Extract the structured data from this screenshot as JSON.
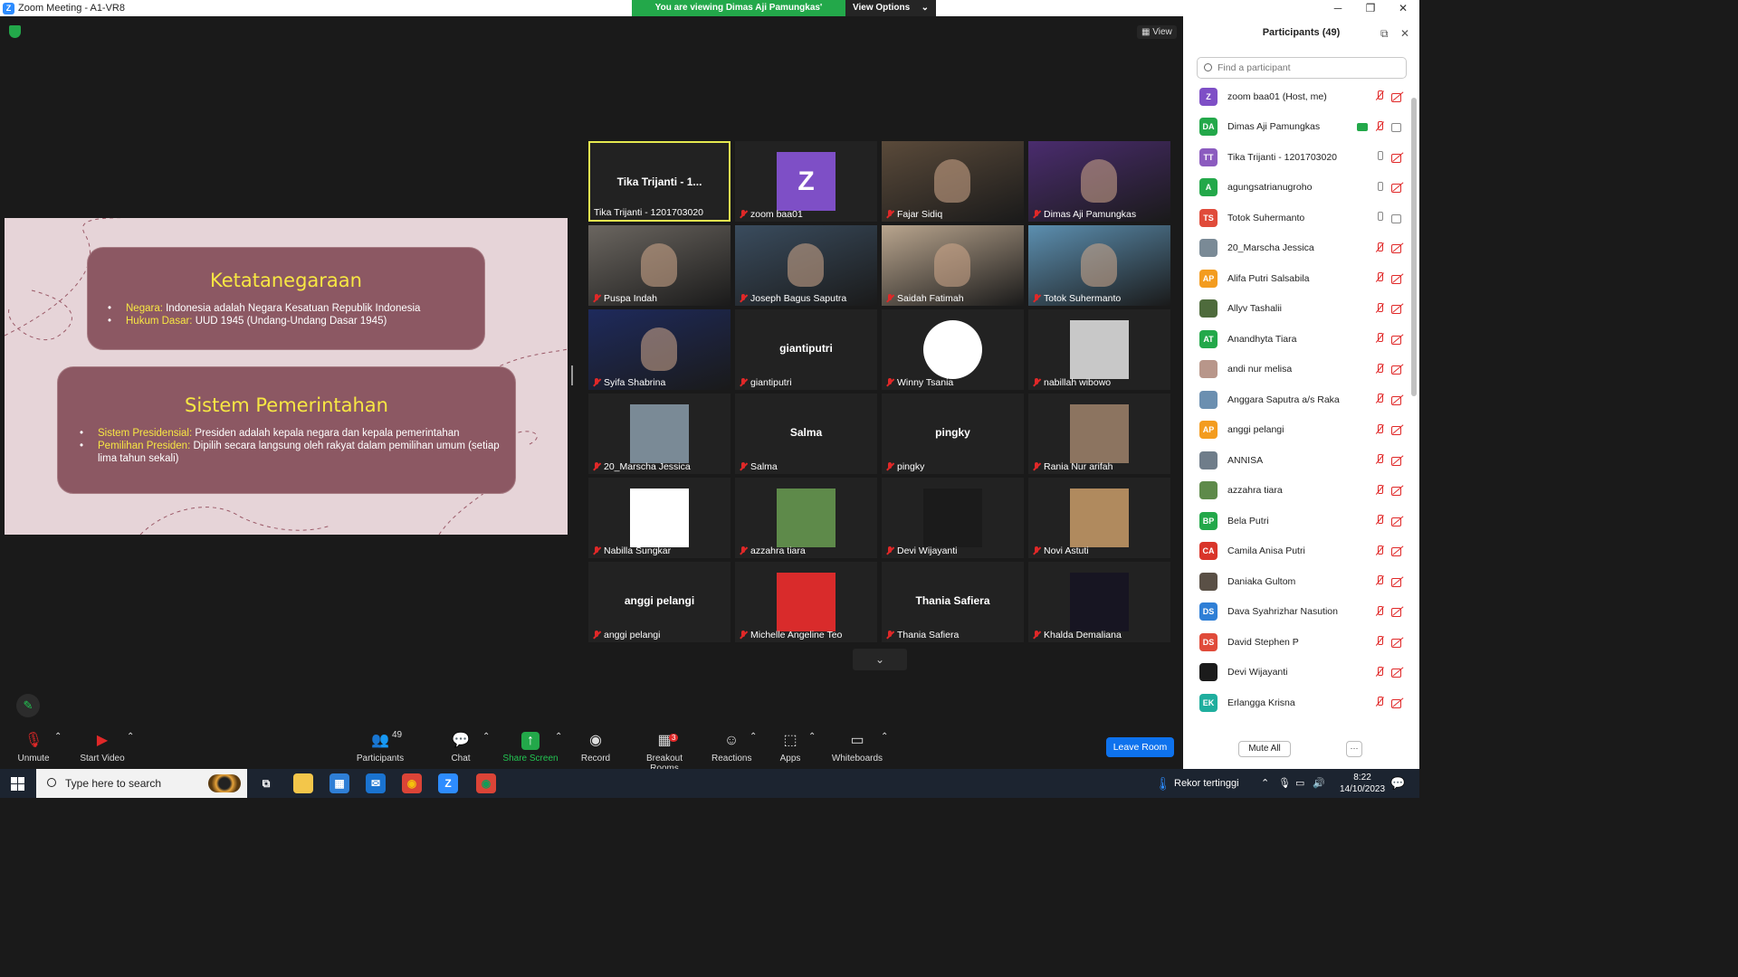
{
  "window": {
    "title": "Zoom Meeting - A1-VR8",
    "app_icon": "zoom-icon",
    "controls": [
      "─",
      "❐",
      "✕"
    ]
  },
  "banner": {
    "viewing": "You are viewing Dimas Aji Pamungkas' screen",
    "options": "View Options",
    "caret": "⌄"
  },
  "view_button": "View",
  "slide": {
    "card1": {
      "title": "Ketatanegaraan",
      "items": [
        {
          "key": "Negara:",
          "text": " Indonesia adalah Negara Kesatuan Republik Indonesia"
        },
        {
          "key": "Hukum Dasar:",
          "text": " UUD 1945 (Undang-Undang Dasar 1945)"
        }
      ]
    },
    "card2": {
      "title": "Sistem Pemerintahan",
      "items": [
        {
          "key": "Sistem Presidensial:",
          "text": " Presiden adalah kepala negara dan kepala pemerintahan"
        },
        {
          "key": "Pemilihan Presiden:",
          "text": " Dipilih secara langsung oleh rakyat dalam pemilihan umum (setiap lima tahun sekali)"
        }
      ]
    },
    "colors": {
      "background": "#e6d4d8",
      "card": "#8c5863",
      "title": "#f7e743"
    }
  },
  "gallery": {
    "tiles": [
      {
        "name": "Tika Trijanti  - 1201703020",
        "big": "Tika Trijanti  - 1...",
        "active": true,
        "muted": false,
        "kind": "text"
      },
      {
        "name": "zoom baa01",
        "kind": "letter",
        "letter": "Z",
        "color": "#7e4fc6"
      },
      {
        "name": "Fajar Sidiq",
        "kind": "video",
        "color": "#5a4a3a"
      },
      {
        "name": "Dimas Aji Pamungkas",
        "kind": "video",
        "color": "#4a2c6e"
      },
      {
        "name": "Puspa Indah",
        "kind": "video",
        "color": "#6b6660"
      },
      {
        "name": "Joseph Bagus Saputra",
        "kind": "video",
        "color": "#3a4c5e"
      },
      {
        "name": "Saidah Fatimah",
        "kind": "video",
        "color": "#b9a58e"
      },
      {
        "name": "Totok Suhermanto",
        "kind": "video",
        "color": "#5c8fb0"
      },
      {
        "name": "Syifa Shabrina",
        "kind": "video",
        "color": "#1e2a5c"
      },
      {
        "name": "giantiputri",
        "kind": "text",
        "big": "giantiputri"
      },
      {
        "name": "Winny Tsania",
        "kind": "avatar",
        "color": "#ffffff"
      },
      {
        "name": "nabillah wibowo",
        "kind": "avatar",
        "color": "#c8c8c8"
      },
      {
        "name": "20_Marscha Jessica",
        "kind": "avatar",
        "color": "#7a8a96"
      },
      {
        "name": "Salma",
        "kind": "text",
        "big": "Salma"
      },
      {
        "name": "pingky",
        "kind": "text",
        "big": "pingky"
      },
      {
        "name": "Rania Nur arifah",
        "kind": "avatar",
        "color": "#8c7460"
      },
      {
        "name": "Nabilla Sungkar",
        "kind": "avatar",
        "color": "#ffffff"
      },
      {
        "name": "azzahra tiara",
        "kind": "avatar",
        "color": "#5e8a4a"
      },
      {
        "name": "Devi Wijayanti",
        "kind": "avatar",
        "color": "#1b1b1b"
      },
      {
        "name": "Novi Astuti",
        "kind": "avatar",
        "color": "#b08a5e"
      },
      {
        "name": "anggi pelangi",
        "kind": "text",
        "big": "anggi pelangi"
      },
      {
        "name": "Michelle Angeline Teo",
        "kind": "avatar",
        "color": "#d92b2b"
      },
      {
        "name": "Thania Safiera",
        "kind": "text",
        "big": "Thania Safiera"
      },
      {
        "name": "Khalda Demaliana",
        "kind": "avatar",
        "color": "#171522"
      }
    ],
    "scroll_down": "⌄"
  },
  "toolbar": {
    "unmute": "Unmute",
    "start_video": "Start Video",
    "participants": "Participants",
    "participants_count": "49",
    "chat": "Chat",
    "share_screen": "Share Screen",
    "record": "Record",
    "breakout_rooms": "Breakout Rooms",
    "breakout_badge": "3",
    "reactions": "Reactions",
    "apps": "Apps",
    "whiteboards": "Whiteboards",
    "leave_room": "Leave Room",
    "caret": "⌃"
  },
  "panel": {
    "title": "Participants (49)",
    "search_placeholder": "Find a participant",
    "mute_all": "Mute All",
    "more": "···",
    "participants": [
      {
        "name": "zoom baa01 (Host, me)",
        "initials": "Z",
        "color": "#7e4fc6",
        "mic": "off",
        "cam": "off"
      },
      {
        "name": "Dimas Aji Pamungkas",
        "initials": "DA",
        "color": "#23a84a",
        "mic": "off",
        "cam": "on",
        "sharing": true
      },
      {
        "name": "Tika Trijanti  - 1201703020",
        "initials": "TT",
        "color": "#8b5bbf",
        "mic": "on",
        "cam": "off"
      },
      {
        "name": "agungsatrianugroho",
        "initials": "A",
        "color": "#23a84a",
        "mic": "on",
        "cam": "off"
      },
      {
        "name": "Totok Suhermanto",
        "initials": "TS",
        "color": "#e04b3a",
        "mic": "on",
        "cam": "on"
      },
      {
        "name": "20_Marscha Jessica",
        "initials": "",
        "color": "#7a8a96",
        "mic": "off",
        "cam": "off"
      },
      {
        "name": "Alifa Putri Salsabila",
        "initials": "AP",
        "color": "#f39c1f",
        "mic": "off",
        "cam": "off"
      },
      {
        "name": "Allyv Tashalii",
        "initials": "",
        "color": "#4e6b3c",
        "mic": "off",
        "cam": "off"
      },
      {
        "name": "Anandhyta Tiara",
        "initials": "AT",
        "color": "#23a84a",
        "mic": "off",
        "cam": "off"
      },
      {
        "name": "andi nur melisa",
        "initials": "",
        "color": "#b8968a",
        "mic": "off",
        "cam": "off"
      },
      {
        "name": "Anggara Saputra a/s Raka",
        "initials": "",
        "color": "#6b8fb0",
        "mic": "off",
        "cam": "off"
      },
      {
        "name": "anggi pelangi",
        "initials": "AP",
        "color": "#f39c1f",
        "mic": "off",
        "cam": "off"
      },
      {
        "name": "ANNISA",
        "initials": "",
        "color": "#6f7d8a",
        "mic": "off",
        "cam": "off"
      },
      {
        "name": "azzahra tiara",
        "initials": "",
        "color": "#5e8a4a",
        "mic": "off",
        "cam": "off"
      },
      {
        "name": "Bela Putri",
        "initials": "BP",
        "color": "#23a84a",
        "mic": "off",
        "cam": "off"
      },
      {
        "name": "Camila Anisa Putri",
        "initials": "CA",
        "color": "#d9352a",
        "mic": "off",
        "cam": "off"
      },
      {
        "name": "Daniaka Gultom",
        "initials": "",
        "color": "#5a5046",
        "mic": "off",
        "cam": "off"
      },
      {
        "name": "Dava Syahrizhar Nasution",
        "initials": "DS",
        "color": "#2f7fd6",
        "mic": "off",
        "cam": "off"
      },
      {
        "name": "David Stephen P",
        "initials": "DS",
        "color": "#e04b3a",
        "mic": "off",
        "cam": "off"
      },
      {
        "name": "Devi Wijayanti",
        "initials": "",
        "color": "#1b1b1b",
        "mic": "off",
        "cam": "off"
      },
      {
        "name": "Erlangga Krisna",
        "initials": "EK",
        "color": "#1fae9e",
        "mic": "off",
        "cam": "off"
      }
    ]
  },
  "taskbar": {
    "search": "Type here to search",
    "weather": "Rekor tertinggi",
    "time": "8:22",
    "date": "14/10/2023",
    "apps": [
      {
        "name": "task-view-icon",
        "glyph": "⧉",
        "bg": "transparent",
        "fg": "#ffffff"
      },
      {
        "name": "file-explorer-icon",
        "glyph": "▬",
        "bg": "#f3c64a",
        "fg": "#f3c64a"
      },
      {
        "name": "store-icon",
        "glyph": "▦",
        "bg": "#2f7fd6",
        "fg": "#ffffff"
      },
      {
        "name": "mail-icon",
        "glyph": "✉",
        "bg": "#1a73d0",
        "fg": "#ffffff"
      },
      {
        "name": "chrome-icon",
        "glyph": "◉",
        "bg": "#db4437",
        "fg": "#f4c20d"
      },
      {
        "name": "zoom-taskbar-icon",
        "glyph": "Z",
        "bg": "#2d8cff",
        "fg": "#ffffff"
      },
      {
        "name": "chrome-profile-icon",
        "glyph": "◉",
        "bg": "#db4437",
        "fg": "#0f9d58"
      }
    ]
  }
}
